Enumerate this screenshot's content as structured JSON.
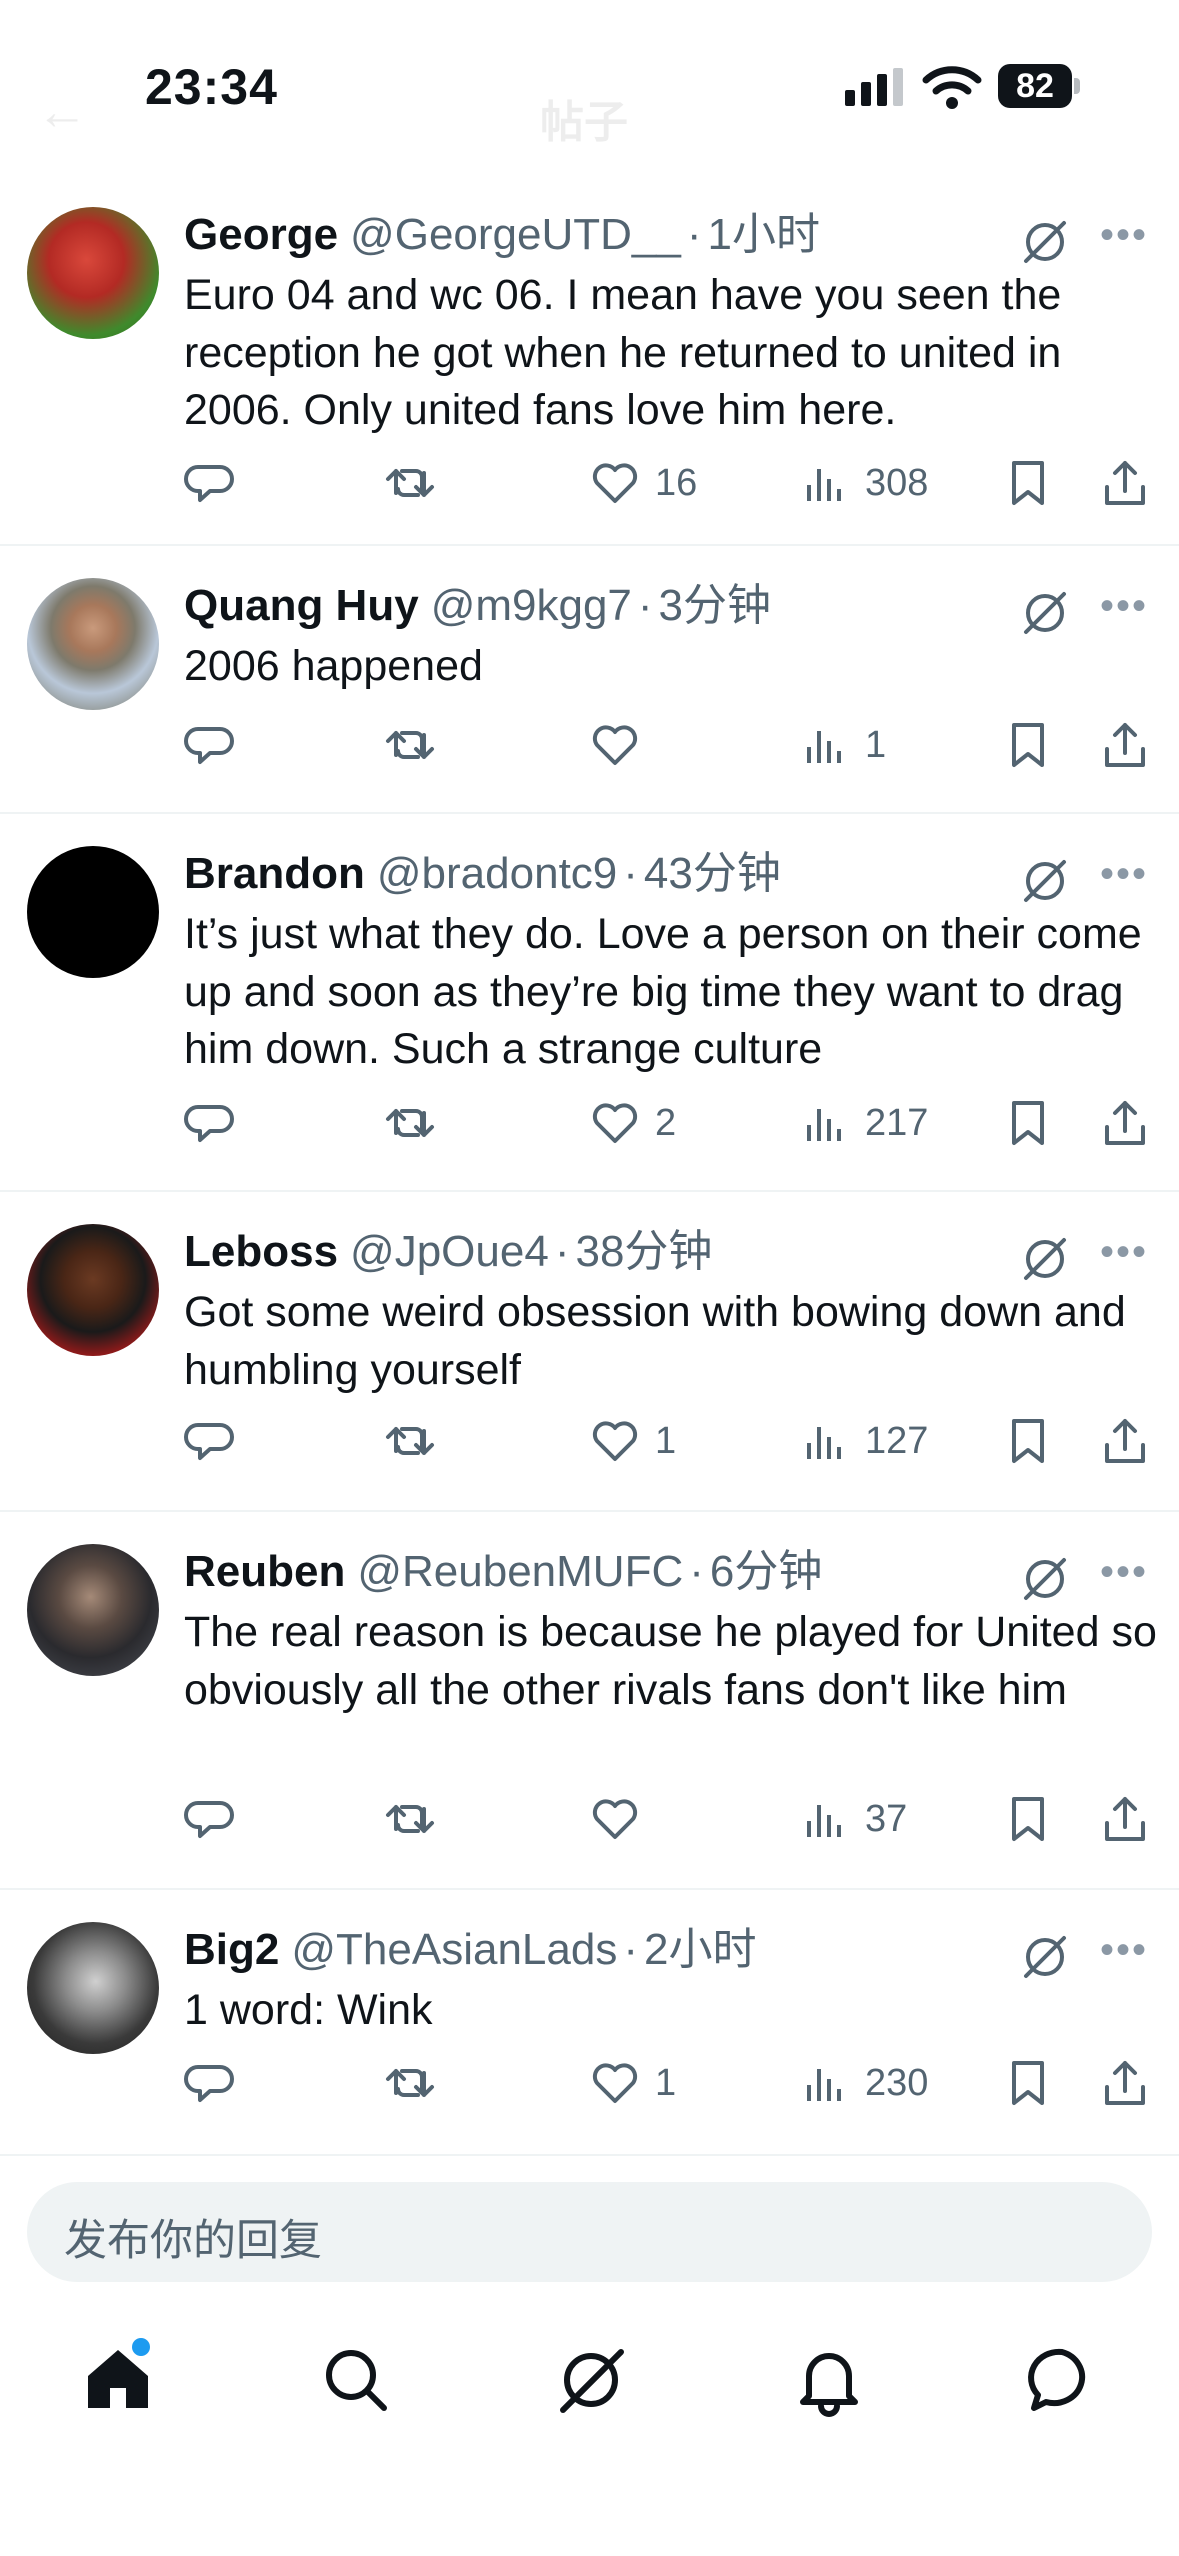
{
  "status_bar": {
    "time": "23:34",
    "battery": "82"
  },
  "header": {
    "title": "帖子"
  },
  "replies": [
    {
      "name": "George",
      "handle": "@GeorgeUTD__",
      "time": "1小时",
      "text": "Euro 04 and wc 06. I mean have you seen the reception he got when he returned to united in 2006. Only united fans love him here.",
      "likes": "16",
      "views": "308"
    },
    {
      "name": "Quang Huy",
      "handle": "@m9kgg7",
      "time": "3分钟",
      "text": "2006 happened",
      "likes": "",
      "views": "1"
    },
    {
      "name": "Brandon",
      "handle": "@bradontc9",
      "time": "43分钟",
      "text": "It’s just what they do. Love a person on their come up and soon as they’re big time they want to drag him down. Such a strange culture",
      "likes": "2",
      "views": "217"
    },
    {
      "name": "Leboss",
      "handle": "@JpOue4",
      "time": "38分钟",
      "text": "Got some weird obsession with bowing down and humbling yourself",
      "likes": "1",
      "views": "127"
    },
    {
      "name": "Reuben",
      "handle": "@ReubenMUFC",
      "time": "6分钟",
      "text": "The real reason is because he played for United so obviously all the other rivals fans don't like him",
      "likes": "",
      "views": "37"
    },
    {
      "name": "Big2",
      "handle": "@TheAsianLads",
      "time": "2小时",
      "text": "1 word: Wink",
      "likes": "1",
      "views": "230"
    }
  ],
  "composer": {
    "placeholder": "发布你的回复"
  },
  "icons": {
    "reply": "reply-icon",
    "retweet": "retweet-icon",
    "like": "heart-icon",
    "views": "views-icon",
    "bookmark": "bookmark-icon",
    "share": "share-icon",
    "grok": "grok-icon",
    "more": "more-icon"
  },
  "nav": {
    "items": [
      "home-icon",
      "search-icon",
      "grok-icon",
      "notifications-icon",
      "messages-icon"
    ]
  },
  "colors": {
    "accent": "#1d9bf0",
    "secondary_text": "#536471",
    "divider": "#eff3f4"
  }
}
